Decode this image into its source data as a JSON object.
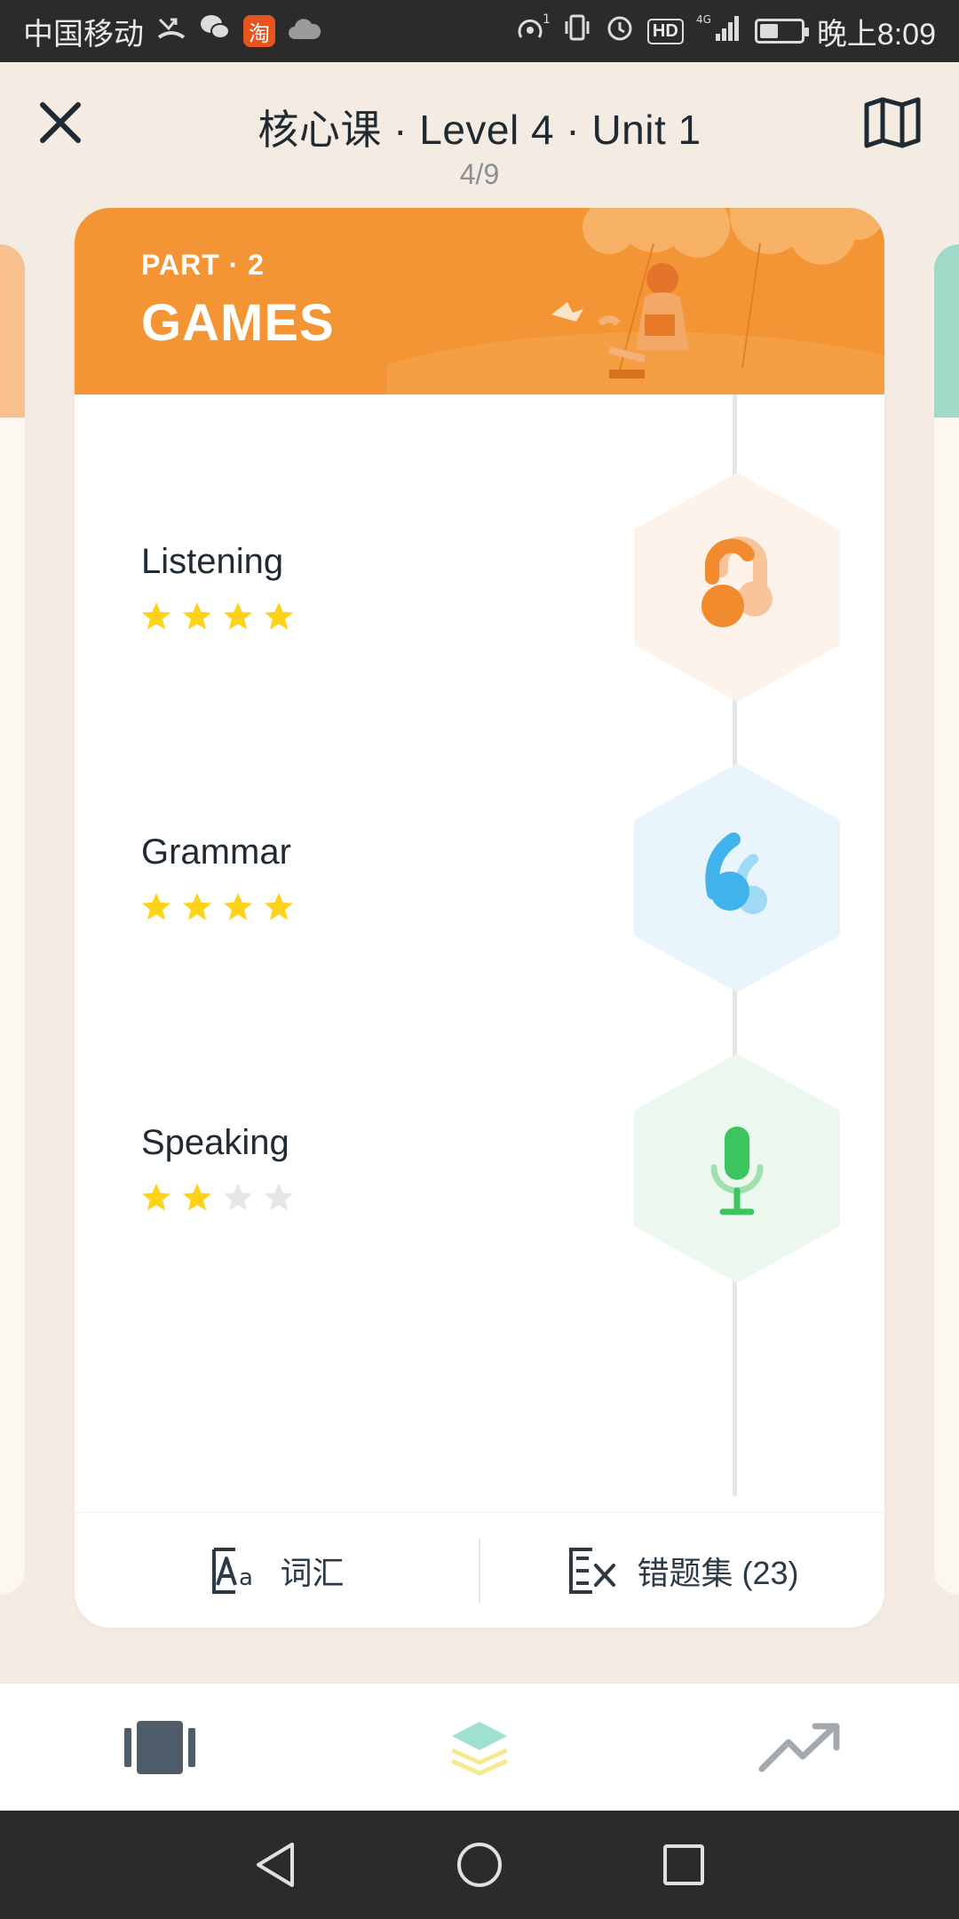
{
  "status_bar": {
    "carrier": "中国移动",
    "taobao_label": "淘",
    "network": "4G",
    "hd_label": "HD",
    "time": "晚上8:09",
    "battery_level": 0.45
  },
  "header": {
    "title": "核心课 · Level 4 · Unit 1",
    "progress": "4/9",
    "close_icon": "close-icon",
    "map_icon": "map-icon"
  },
  "card": {
    "part_label": "PART · 2",
    "part_title": "GAMES",
    "accent_color": "#f39535",
    "items": [
      {
        "label": "Listening",
        "stars": 4,
        "max_stars": 4,
        "icon": "headphones-icon",
        "hex_color": "#fdf3ea",
        "icon_color": "#f28a2e"
      },
      {
        "label": "Grammar",
        "stars": 4,
        "max_stars": 4,
        "icon": "quote-icon",
        "hex_color": "#e8f5fc",
        "icon_color": "#3fb3ea"
      },
      {
        "label": "Speaking",
        "stars": 2,
        "max_stars": 4,
        "icon": "microphone-icon",
        "hex_color": "#ecf8ee",
        "icon_color": "#3cc45e"
      }
    ],
    "footer": {
      "vocab_label": "词汇",
      "mistakes_label": "错题集 (23)"
    }
  },
  "tabbar": {
    "tabs": [
      {
        "icon": "cards-icon",
        "active": false
      },
      {
        "icon": "layers-icon",
        "active": true
      },
      {
        "icon": "trend-icon",
        "active": false
      }
    ]
  },
  "colors": {
    "star_on": "#ffd21a",
    "star_off": "#e6e6e6",
    "background": "#f4ece2"
  }
}
